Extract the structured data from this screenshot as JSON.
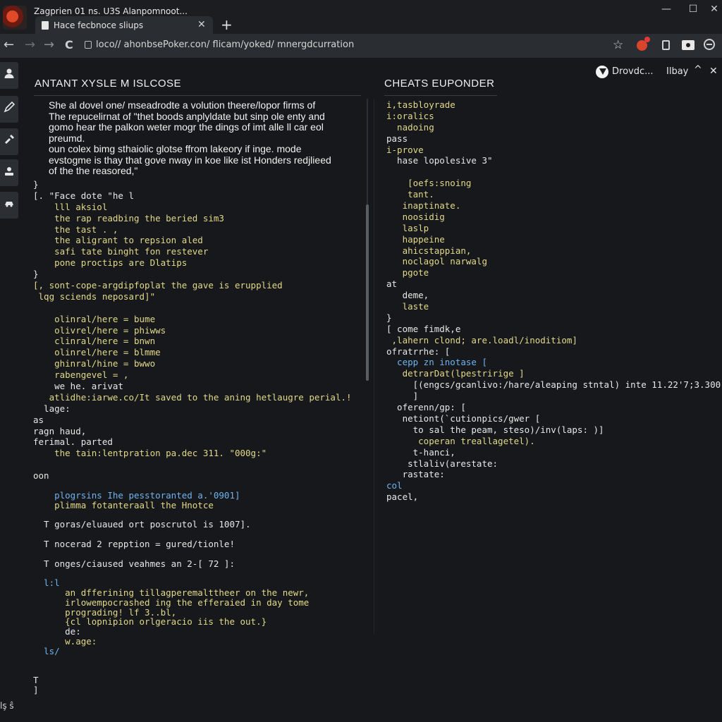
{
  "window": {
    "title": "Zagprien 01 ns. U3S Alanpomnoot...",
    "controls": {
      "minimize": "—",
      "maximize": "☐",
      "close": "✕"
    }
  },
  "tab": {
    "title": "Hace fecbnoce sliups",
    "close": "✕",
    "new_tab": "+"
  },
  "nav": {
    "back": "←",
    "forward_dim": "→",
    "forward": "→",
    "reload": "C",
    "url": "loco// ahonbsePoker.con/ flicam/yoked/ mnergdcurration",
    "star": "☆"
  },
  "topright": {
    "label1": "Drovdc...",
    "label2": "Ilbay",
    "up": "^",
    "close": "✕"
  },
  "sidebar": {
    "icons": [
      "person-icon",
      "pen-icon",
      "tools-icon",
      "user-card-icon",
      "car-icon"
    ]
  },
  "left_panel": {
    "title": "ANTANT XYSLE M ISLCOSE",
    "prose": [
      "She al dovel one/ mseadrodte a volution theere/lopor firms of",
      "The repucelirnat of \"thet boods anplyldate but sinp ole enty and",
      "gomo hear the palkon weter mogr the dings of imt alle ll car eol",
      "preumd.",
      "oun colex bimg sthaiolic glotse ffrom lakeory if inge. mode",
      "evstogme is thay that gove nway in koe like ist Honders redjlieed",
      "of the the reasored,\""
    ],
    "code": [
      {
        "text": "}",
        "color": "#e8e8e8",
        "indent": 0
      },
      {
        "text": "[. \"Face dote \"he l",
        "color": "#e8e8e8",
        "indent": 0
      },
      {
        "text": "    lll aksiol",
        "color": "#e3d98a",
        "indent": 0
      },
      {
        "text": "    the rap readbing the beried sim3",
        "color": "#e3d98a",
        "indent": 0
      },
      {
        "text": "    the tast . ,",
        "color": "#e3d98a",
        "indent": 0
      },
      {
        "text": "    the aligrant to repsion aled",
        "color": "#e3d98a",
        "indent": 0
      },
      {
        "text": "    safi tate binght fon restever",
        "color": "#e3d98a",
        "indent": 0
      },
      {
        "text": "    pone proctips are Dlatips",
        "color": "#e3d98a",
        "indent": 0
      },
      {
        "text": "}",
        "color": "#e8e8e8",
        "indent": 0
      },
      {
        "text": "[, sont-cope-argdipfoplat the gave is erupplied",
        "color": "#e3d98a",
        "indent": 0
      },
      {
        "text": " lqg sciends neposard]\"",
        "color": "#e3d98a",
        "indent": 0
      },
      {
        "text": "",
        "color": "#e8e8e8",
        "indent": 0
      },
      {
        "text": "    olinral/here = bume",
        "color": "#e3d98a",
        "indent": 0
      },
      {
        "text": "    olivrel/here = phiwws",
        "color": "#e3d98a",
        "indent": 0
      },
      {
        "text": "    clinral/here = bnwn",
        "color": "#e3d98a",
        "indent": 0
      },
      {
        "text": "    olinrel/here = blmme",
        "color": "#e3d98a",
        "indent": 0
      },
      {
        "text": "    ghinral/hine = bwwo",
        "color": "#e3d98a",
        "indent": 0
      },
      {
        "text": "    rabengevel = ,",
        "color": "#e3d98a",
        "indent": 0
      },
      {
        "text": "    we he. arivat",
        "color": "#e8e8e8",
        "indent": 0
      },
      {
        "text": "   atlidhe:iarwe.co/It saved to the aning hetlaugre perial.!",
        "color": "#e3d98a",
        "indent": 0
      },
      {
        "text": "  lage:",
        "color": "#e8e8e8",
        "indent": 0
      },
      {
        "text": "as",
        "color": "#e8e8e8",
        "indent": 0
      },
      {
        "text": "ragn haud,",
        "color": "#e8e8e8",
        "indent": 0
      },
      {
        "text": "ferimal. parted",
        "color": "#e8e8e8",
        "indent": 0
      },
      {
        "text": "    the tain:lentpration pa.dec 311. \"000g:\"",
        "color": "#e3d98a",
        "indent": 0
      },
      {
        "text": "",
        "color": "#e8e8e8",
        "indent": 0
      },
      {
        "text": "oon",
        "color": "#e8e8e8",
        "indent": 0
      }
    ],
    "code2": [
      {
        "text": "    plogrsins Ihe pesstoranted a.'0901]",
        "color": "#6fb4f0"
      },
      {
        "text": "    plimma fotanteraall the Hnotce",
        "color": "#e3d98a"
      },
      {
        "text": "",
        "color": "#e8e8e8"
      },
      {
        "text": "  T goras/eluaued ort poscrutol is 1007].",
        "color": "#e8e8e8"
      },
      {
        "text": "",
        "color": "#e8e8e8"
      },
      {
        "text": "  T nocerad 2 repption = gured/tionle!",
        "color": "#e8e8e8"
      },
      {
        "text": "",
        "color": "#e8e8e8"
      },
      {
        "text": "  T onges/ciaused veahmes an 2-[ 72 ]:",
        "color": "#e8e8e8"
      },
      {
        "text": "",
        "color": "#e8e8e8"
      },
      {
        "text": "  l:l",
        "color": "#6fb4f0"
      },
      {
        "text": "      an dfferining tillagperemalttheer on the newr,",
        "color": "#e3d98a"
      },
      {
        "text": "      irlowempocrashed ing the efferaied in day tome",
        "color": "#e3d98a"
      },
      {
        "text": "      prograding! lf 3..bl,",
        "color": "#e3d98a"
      },
      {
        "text": "      {cl lopnipion orlgeracio iis the out.}",
        "color": "#e3d98a"
      },
      {
        "text": "      de:",
        "color": "#e8e8e8"
      },
      {
        "text": "      w.age:",
        "color": "#e3d98a"
      },
      {
        "text": "  ls/",
        "color": "#6fb4f0"
      },
      {
        "text": "",
        "color": "#e8e8e8"
      },
      {
        "text": "",
        "color": "#e8e8e8"
      },
      {
        "text": "T",
        "color": "#e8e8e8"
      },
      {
        "text": "]",
        "color": "#e8e8e8"
      }
    ]
  },
  "right_panel": {
    "title": "CHEATS EUPONDER",
    "code": [
      {
        "text": "i,tasbloyrade",
        "color": "#e3d98a"
      },
      {
        "text": "i:oralics",
        "color": "#e3d98a"
      },
      {
        "text": "  nadoing",
        "color": "#e3d98a"
      },
      {
        "text": "pass",
        "color": "#e8e8e8"
      },
      {
        "text": "i-prove",
        "color": "#e3d98a"
      },
      {
        "text": "  hase lopolesive 3\"",
        "color": "#e8e8e8"
      },
      {
        "text": "",
        "color": "#e8e8e8"
      },
      {
        "text": "    [oefs:snoing",
        "color": "#e3d98a"
      },
      {
        "text": "    tant.",
        "color": "#e3d98a"
      },
      {
        "text": "   inaptinate.",
        "color": "#e3d98a"
      },
      {
        "text": "   noosidig",
        "color": "#e3d98a"
      },
      {
        "text": "   laslp",
        "color": "#e3d98a"
      },
      {
        "text": "   happeine",
        "color": "#e3d98a"
      },
      {
        "text": "   ahicstappian,",
        "color": "#e3d98a"
      },
      {
        "text": "   noclagol narwalg",
        "color": "#e3d98a"
      },
      {
        "text": "   pgote",
        "color": "#e3d98a"
      },
      {
        "text": "at",
        "color": "#e8e8e8"
      },
      {
        "text": "   deme,",
        "color": "#e8e8e8"
      },
      {
        "text": "   laste",
        "color": "#e3d98a"
      },
      {
        "text": "}",
        "color": "#e8e8e8"
      },
      {
        "text": "[ come fimdk,e",
        "color": "#e8e8e8"
      },
      {
        "text": " ,lahern clond; are.loadl/inoditiom]",
        "color": "#e3d98a"
      },
      {
        "text": "ofratrrhe: [",
        "color": "#e8e8e8"
      },
      {
        "text": "  cepp zn inotase [",
        "color": "#6fb4f0"
      },
      {
        "text": "   detrarDat(lpestririge ]",
        "color": "#e3d98a"
      },
      {
        "text": "     [(engcs/gcanlivo:/hare/aleaping stntal) inte 11.22'7;3.300",
        "color": "#e8e8e8"
      },
      {
        "text": "     ]",
        "color": "#e8e8e8"
      },
      {
        "text": "  oferenn/gp: [",
        "color": "#e8e8e8"
      },
      {
        "text": "   netiont(`cutionpics/gwer [",
        "color": "#e8e8e8"
      },
      {
        "text": "     to sal the peam, steso)/inv(laps: )]",
        "color": "#e8e8e8"
      },
      {
        "text": "      coperan treallagetel).",
        "color": "#e3d98a"
      },
      {
        "text": "     t-hanci,",
        "color": "#e8e8e8"
      },
      {
        "text": "    stlaliv(arestate:",
        "color": "#e8e8e8"
      },
      {
        "text": "   rastate:",
        "color": "#e8e8e8"
      },
      {
        "text": "col",
        "color": "#6fb4f0"
      },
      {
        "text": "pacel,",
        "color": "#e8e8e8"
      }
    ]
  },
  "footer": {
    "corner": "lş ŝ"
  }
}
